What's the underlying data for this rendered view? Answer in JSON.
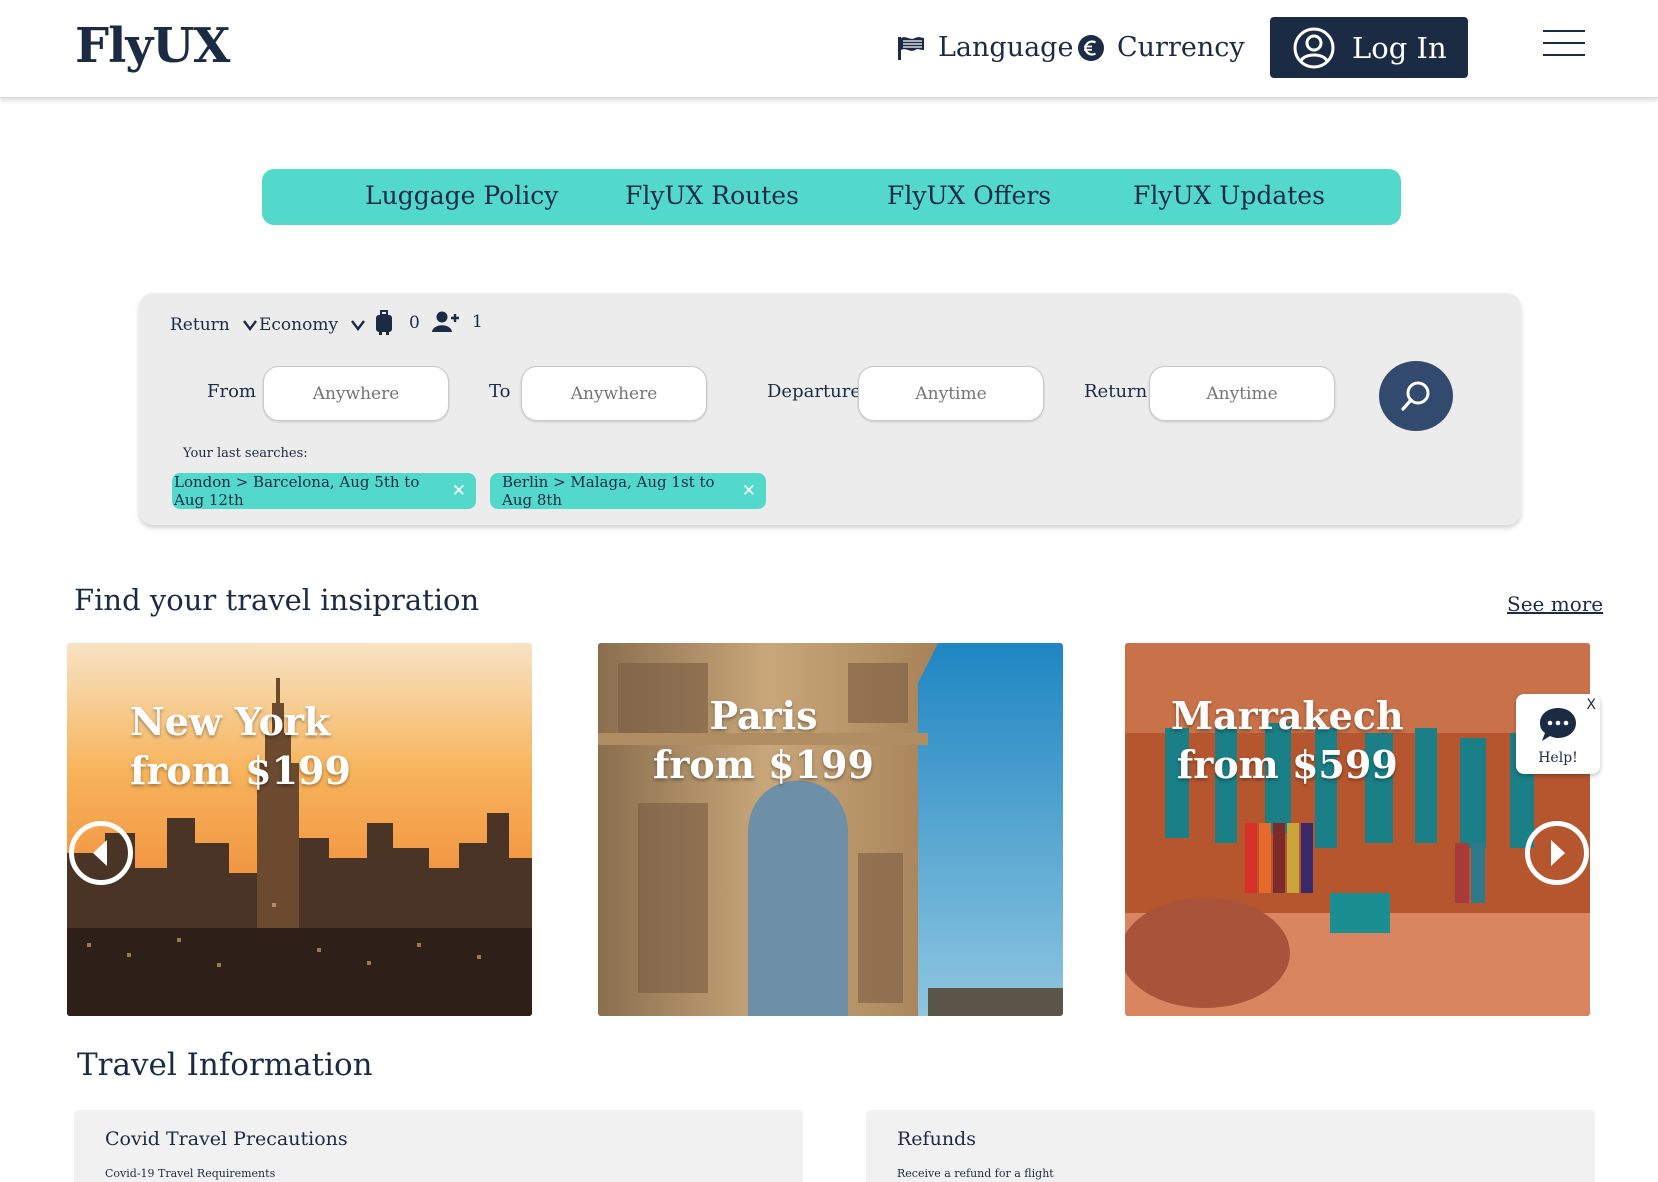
{
  "header": {
    "logo": "FlyUX",
    "language_label": "Language",
    "currency_label": "Currency",
    "login_label": "Log In"
  },
  "nav": {
    "items": [
      "Luggage Policy",
      "FlyUX Routes",
      "FlyUX Offers",
      "FlyUX Updates"
    ]
  },
  "search": {
    "trip_type": "Return",
    "cabin_class": "Economy",
    "bags_count": "0",
    "passengers_count": "1",
    "from_label": "From",
    "from_placeholder": "Anywhere",
    "to_label": "To",
    "to_placeholder": "Anywhere",
    "departure_label": "Departure",
    "departure_placeholder": "Anytime",
    "return_label": "Return",
    "return_placeholder": "Anytime",
    "last_searches_label": "Your last searches:",
    "last_searches": [
      "London > Barcelona, Aug 5th to Aug 12th",
      "Berlin > Malaga, Aug 1st to Aug 8th"
    ],
    "chip_close": "✕"
  },
  "inspiration": {
    "title": "Find your travel insipration",
    "see_more": "See more",
    "cards": [
      {
        "city": "New York",
        "price": "from $199"
      },
      {
        "city": "Paris",
        "price": "from $199"
      },
      {
        "city": "Marrakech",
        "price": "from $599"
      }
    ]
  },
  "help": {
    "label": "Help!",
    "close": "X"
  },
  "travel_info": {
    "title": "Travel Information",
    "cards": [
      {
        "title": "Covid Travel Precautions",
        "subtitle": "Covid-19 Travel Requirements"
      },
      {
        "title": "Refunds",
        "subtitle": "Receive a refund for a flight"
      }
    ]
  },
  "colors": {
    "navy": "#1c2b44",
    "teal": "#52d9cc",
    "search_button": "#324a6e",
    "panel": "#ececec"
  },
  "icons": [
    "flag-icon",
    "euro-icon",
    "user-avatar-icon",
    "hamburger-menu-icon",
    "chevron-down-icon",
    "luggage-icon",
    "add-person-icon",
    "search-icon",
    "close-icon",
    "chevron-left-icon",
    "chevron-right-icon",
    "chat-bubble-icon"
  ]
}
